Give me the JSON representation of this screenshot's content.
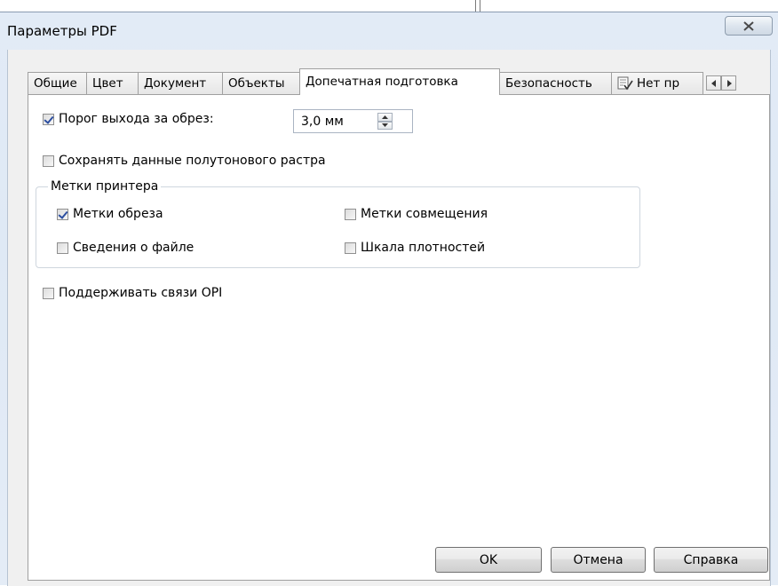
{
  "window": {
    "title": "Параметры PDF"
  },
  "tabs": [
    {
      "label": "Общие"
    },
    {
      "label": "Цвет"
    },
    {
      "label": "Документ"
    },
    {
      "label": "Объекты"
    },
    {
      "label": "Допечатная подготовка",
      "active": true
    },
    {
      "label": "Безопасность"
    },
    {
      "label": "Нет пр",
      "icon": "checklist-icon"
    }
  ],
  "prepress": {
    "bleed": {
      "label": "Порог выхода за обрез:",
      "checked": true,
      "value": "3,0 мм"
    },
    "halftone": {
      "label": "Сохранять данные полутонового растра",
      "checked": false
    },
    "printer_marks": {
      "title": "Метки принтера",
      "crop_marks": {
        "label": "Метки обреза",
        "checked": true
      },
      "registration_marks": {
        "label": "Метки совмещения",
        "checked": false
      },
      "file_info": {
        "label": "Сведения о файле",
        "checked": false
      },
      "density_scale": {
        "label": "Шкала плотностей",
        "checked": false
      }
    },
    "opi": {
      "label": "Поддерживать связи OPI",
      "checked": false
    }
  },
  "buttons": {
    "ok": "OK",
    "cancel": "Отмена",
    "help": "Справка"
  },
  "colors": {
    "checkmark": "#2c4ea0",
    "window_frame": "#dfe9f5"
  }
}
